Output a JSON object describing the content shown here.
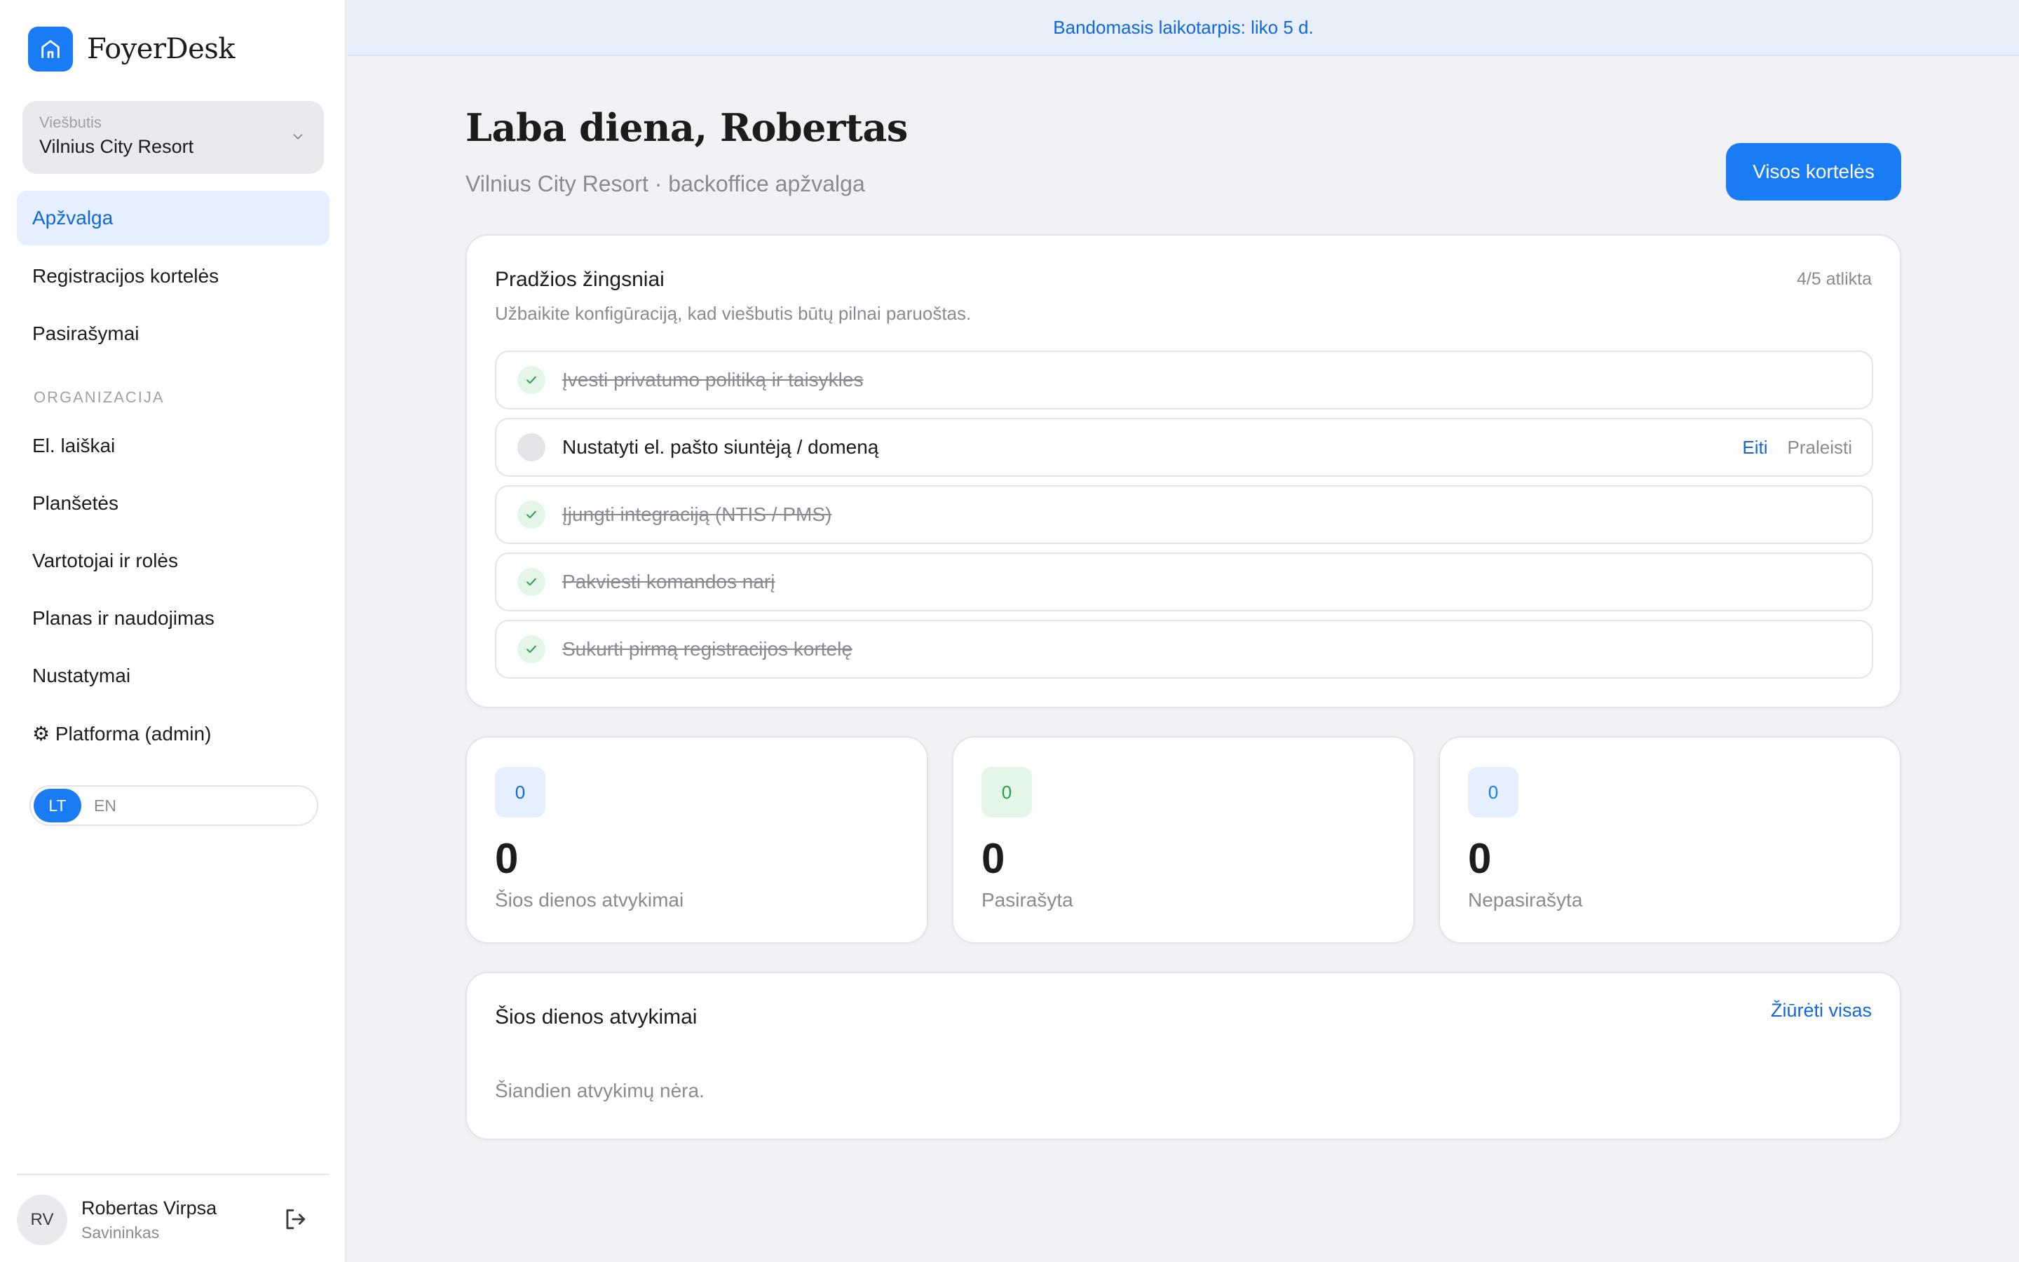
{
  "banner": {
    "text": "Bandomasis laikotarpis: liko 5 d."
  },
  "brand": {
    "name": "FoyerDesk",
    "icon": "home-icon"
  },
  "hotel_select": {
    "label": "Viešbutis",
    "value": "Vilnius City Resort"
  },
  "nav": {
    "items": [
      {
        "label": "Apžvalga",
        "active": true
      },
      {
        "label": "Registracijos kortelės"
      },
      {
        "label": "Pasirašymai"
      }
    ],
    "section_label": "ORGANIZACIJA",
    "org_items": [
      {
        "label": "El. laiškai"
      },
      {
        "label": "Planšetės"
      },
      {
        "label": "Vartotojai ir rolės"
      },
      {
        "label": "Planas ir naudojimas"
      },
      {
        "label": "Nustatymai"
      },
      {
        "label": "⚙ Platforma (admin)"
      }
    ]
  },
  "language": {
    "options": [
      "LT",
      "EN"
    ],
    "selected": "LT"
  },
  "user": {
    "initials": "RV",
    "name": "Robertas Virpsa",
    "role": "Savininkas"
  },
  "header": {
    "greeting": "Laba diena, Robertas",
    "subtitle": "Vilnius City Resort · backoffice apžvalga",
    "primary_button": "Visos kortelės"
  },
  "onboarding": {
    "title": "Pradžios žingsniai",
    "description": "Užbaikite konfigūraciją, kad viešbutis būtų pilnai paruoštas.",
    "progress": "4/5 atlikta",
    "steps": [
      {
        "label": "Įvesti privatumo politiką ir taisykles",
        "done": true
      },
      {
        "label": "Nustatyti el. pašto siuntėją / domeną",
        "done": false,
        "action_go": "Eiti",
        "action_skip": "Praleisti"
      },
      {
        "label": "Įjungti integraciją (NTIS / PMS)",
        "done": true
      },
      {
        "label": "Pakviesti komandos narį",
        "done": true
      },
      {
        "label": "Sukurti pirmą registracijos kortelę",
        "done": true
      }
    ]
  },
  "stats": [
    {
      "badge": "0",
      "value": "0",
      "label": "Šios dienos atvykimai",
      "badge_bg": "#e5effd",
      "badge_color": "#1267d9"
    },
    {
      "badge": "0",
      "value": "0",
      "label": "Pasirašyta",
      "badge_bg": "#e3f6e8",
      "badge_color": "#2a9d4b"
    },
    {
      "badge": "0",
      "value": "0",
      "label": "Nepasirašyta",
      "badge_bg": "#e5effd",
      "badge_color": "#1a7cf5"
    }
  ],
  "arrivals": {
    "title": "Šios dienos atvykimai",
    "view_all": "Žiūrėti visas",
    "empty_text": "Šiandien atvykimų nėra."
  },
  "colors": {
    "accent": "#1a7cf5",
    "accent_text": "#1267d9",
    "success": "#2a9d4b",
    "background": "#f2f2f6"
  }
}
